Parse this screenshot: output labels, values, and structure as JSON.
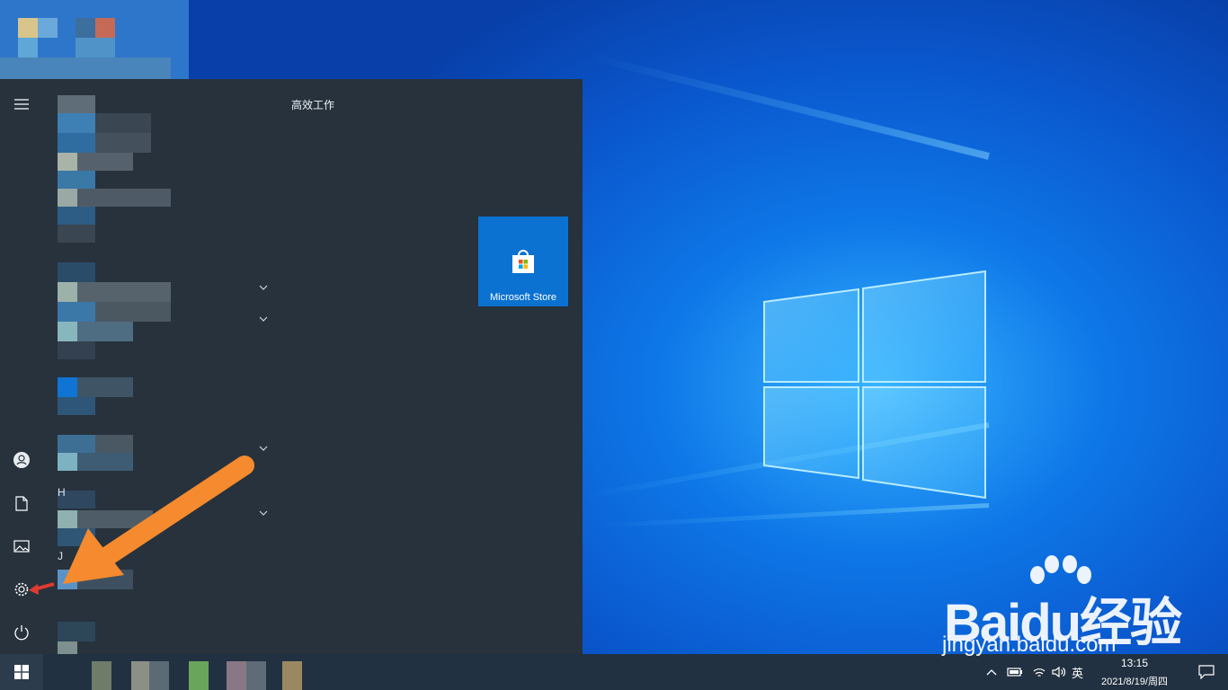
{
  "start_menu": {
    "group_title": "高效工作",
    "tile_label": "Microsoft Store",
    "letters": [
      "H",
      "J"
    ]
  },
  "rail_icons": [
    "menu-icon",
    "user-icon",
    "document-icon",
    "pictures-icon",
    "settings-icon",
    "power-icon"
  ],
  "taskbar": {
    "language": "英",
    "time": "13:15",
    "date": "2021/8/19/周四"
  },
  "watermark": {
    "brand": "Baidu经验",
    "url": "jingyan.baidu.com"
  },
  "colors": {
    "accent_tile": "#0b72d2",
    "menu_bg": "#27323c",
    "taskbar_bg": "#223141",
    "arrow": "#f58a2e"
  }
}
